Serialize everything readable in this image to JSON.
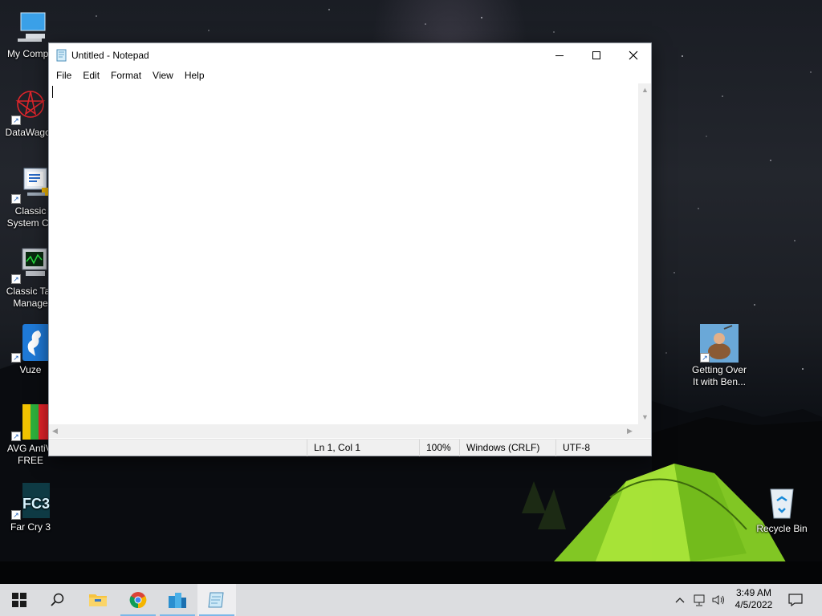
{
  "window": {
    "title": "Untitled - Notepad",
    "menu": [
      "File",
      "Edit",
      "Format",
      "View",
      "Help"
    ],
    "content": "",
    "status": {
      "position": "Ln 1, Col 1",
      "zoom": "100%",
      "line_ending": "Windows (CRLF)",
      "encoding": "UTF-8"
    }
  },
  "desktop_icons": [
    {
      "label": "My Compu",
      "icon": "computer-icon",
      "shortcut": false
    },
    {
      "label": "DataWagon",
      "icon": "datawagon-icon",
      "shortcut": true
    },
    {
      "label": "Classic System Co",
      "icon": "control-panel-icon",
      "shortcut": true
    },
    {
      "label": "Classic Tas Manage",
      "icon": "task-manager-icon",
      "shortcut": true
    },
    {
      "label": "Vuze",
      "icon": "vuze-icon",
      "shortcut": true
    },
    {
      "label": "AVG AntiVi FREE",
      "icon": "avg-icon",
      "shortcut": true
    },
    {
      "label": "Far Cry 3",
      "icon": "far-cry-icon",
      "shortcut": true
    },
    {
      "label": "Getting Over It with Ben...",
      "icon": "getting-over-it-icon",
      "shortcut": true
    },
    {
      "label": "Recycle Bin",
      "icon": "recycle-bin-icon",
      "shortcut": false
    }
  ],
  "taskbar": {
    "pinned": [
      "windows-start-icon",
      "search-icon",
      "file-explorer-icon",
      "chrome-icon",
      "app-buildings-icon",
      "notepad-icon"
    ],
    "clock": {
      "time": "3:49 AM",
      "date": "4/5/2022"
    },
    "tray": [
      "chevron-up-icon",
      "network-icon",
      "volume-icon",
      "notification-icon"
    ]
  },
  "colors": {
    "taskbar": "#dcdde0",
    "active_indicator": "#7cb8e8",
    "window_bg": "#ffffff",
    "statusbar_bg": "#f0f0f0",
    "tent_glow": "#9be62a"
  }
}
